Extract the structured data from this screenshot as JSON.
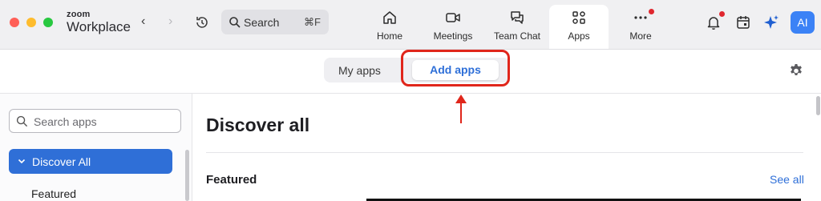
{
  "titlebar": {
    "brand_top": "zoom",
    "brand_bottom": "Workplace",
    "back_arrow": "‹",
    "forward_arrow": "›",
    "search_label": "Search",
    "search_shortcut": "⌘F",
    "avatar_initials": "AI"
  },
  "tabs": [
    {
      "label": "Home",
      "icon": "home-icon"
    },
    {
      "label": "Meetings",
      "icon": "video-camera-icon"
    },
    {
      "label": "Team Chat",
      "icon": "chat-bubbles-icon"
    },
    {
      "label": "Apps",
      "icon": "apps-grid-icon",
      "active": true
    },
    {
      "label": "More",
      "icon": "more-dots-icon",
      "notification": true
    }
  ],
  "segmented": {
    "my_apps": "My apps",
    "add_apps": "Add apps"
  },
  "sidebar": {
    "search_placeholder": "Search apps",
    "items": [
      {
        "label": "Discover All",
        "selected": true
      },
      {
        "label": "Featured"
      }
    ]
  },
  "main": {
    "title": "Discover all",
    "section_title": "Featured",
    "see_all": "See all"
  },
  "colors": {
    "accent": "#2e6fd8",
    "annotation": "#e0261b",
    "notification": "#e0272f"
  }
}
